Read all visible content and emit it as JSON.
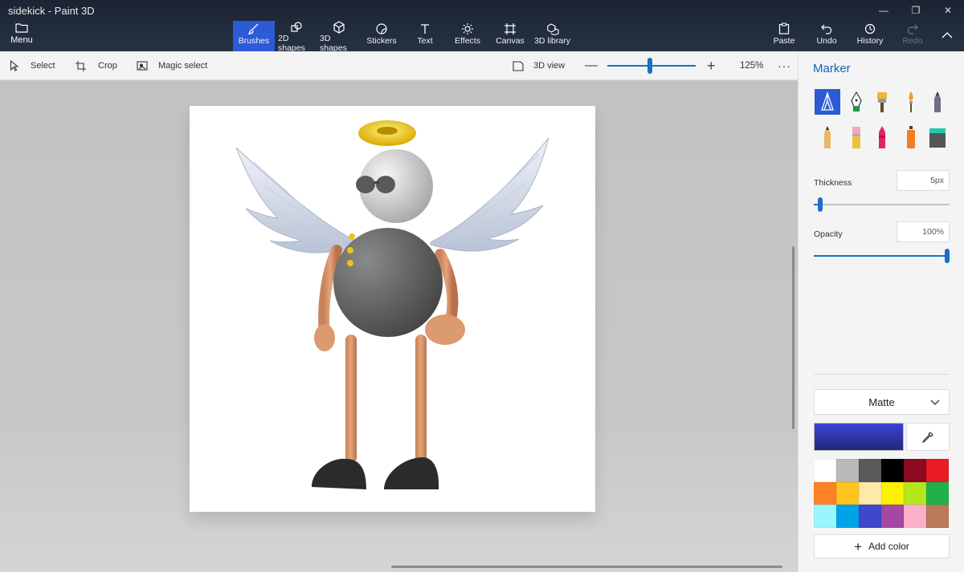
{
  "window": {
    "title": "sidekick - Paint 3D"
  },
  "ribbon": {
    "menu_label": "Menu",
    "tabs": [
      {
        "label": "Brushes",
        "icon": "brush-icon"
      },
      {
        "label": "2D shapes",
        "icon": "2d-shapes-icon"
      },
      {
        "label": "3D shapes",
        "icon": "3d-shapes-icon"
      },
      {
        "label": "Stickers",
        "icon": "stickers-icon"
      },
      {
        "label": "Text",
        "icon": "text-icon"
      },
      {
        "label": "Effects",
        "icon": "effects-icon"
      },
      {
        "label": "Canvas",
        "icon": "canvas-icon"
      },
      {
        "label": "3D library",
        "icon": "3d-library-icon"
      }
    ],
    "active_tab": "Brushes",
    "actions": [
      {
        "label": "Paste",
        "icon": "paste-icon"
      },
      {
        "label": "Undo",
        "icon": "undo-icon"
      },
      {
        "label": "History",
        "icon": "history-icon"
      },
      {
        "label": "Redo",
        "icon": "redo-icon"
      }
    ]
  },
  "toolbar": {
    "select_label": "Select",
    "crop_label": "Crop",
    "magic_select_label": "Magic select",
    "view3d_label": "3D view",
    "zoom_percent": "125%",
    "zoom_slider_value": 0.48
  },
  "panel": {
    "title": "Marker",
    "tools": [
      "marker-icon",
      "calligraphy-pen-icon",
      "oil-brush-icon",
      "watercolor-icon",
      "pixel-pen-icon",
      "pencil-icon",
      "eraser-icon",
      "crayon-icon",
      "spray-can-icon",
      "fill-bucket-icon"
    ],
    "thickness_label": "Thickness",
    "thickness_value": "5px",
    "thickness_fraction": 0.05,
    "opacity_label": "Opacity",
    "opacity_value": "100%",
    "opacity_fraction": 1.0,
    "finish_value": "Matte",
    "current_color": "#3a44d4",
    "palette": [
      "#ffffff",
      "#b9b9b9",
      "#5a5a5a",
      "#000000",
      "#8b0a1f",
      "#ea1c24",
      "#fd8126",
      "#fec51e",
      "#fde9a8",
      "#fef100",
      "#b5e61d",
      "#20b14c",
      "#98f7fe",
      "#00a3e8",
      "#3f48cc",
      "#a349a3",
      "#fbafc9",
      "#b97a57"
    ],
    "add_color_label": "Add color"
  }
}
